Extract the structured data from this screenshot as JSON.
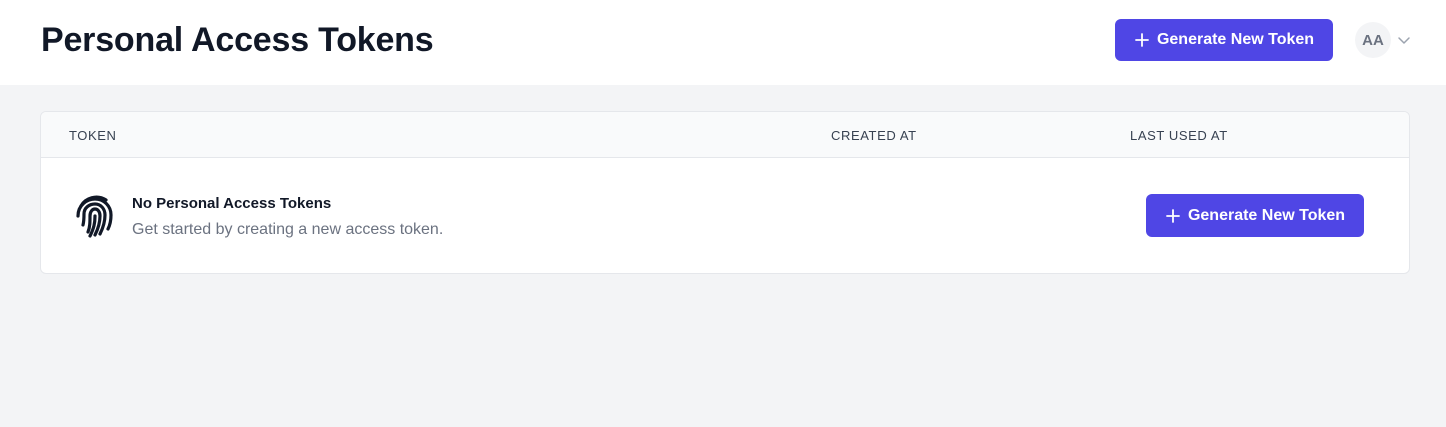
{
  "header": {
    "title": "Personal Access Tokens",
    "generate_label": "Generate New Token",
    "avatar_initials": "AA"
  },
  "table": {
    "columns": [
      "TOKEN",
      "CREATED AT",
      "LAST USED AT"
    ],
    "empty_state": {
      "title": "No Personal Access Tokens",
      "subtitle": "Get started by creating a new access token.",
      "button_label": "Generate New Token"
    }
  },
  "colors": {
    "primary": "#4f46e5",
    "background": "#f3f4f6",
    "header_bg": "#ffffff",
    "table_head_bg": "#f9fafb",
    "muted_text": "#6b7280"
  },
  "icons": [
    "plus-icon",
    "chevron-down-icon",
    "fingerprint-icon"
  ]
}
